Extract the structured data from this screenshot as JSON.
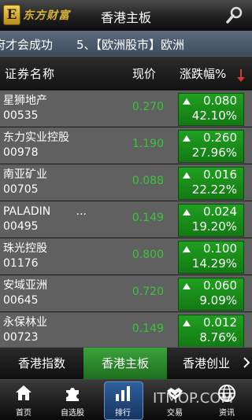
{
  "app": {
    "logo_letter": "E",
    "logo_text": "东方财富",
    "title": "香港主板"
  },
  "ticker": {
    "text": "府才会成功　　5、【欧洲股市】欧洲"
  },
  "header": {
    "name": "证券名称",
    "price": "现价",
    "change": "涨跌幅%"
  },
  "rows": [
    {
      "name": "星狮地产",
      "code": "00535",
      "price": "0.270",
      "change": "0.080",
      "pct": "42.10%"
    },
    {
      "name": "东力实业控股",
      "code": "00978",
      "price": "1.190",
      "change": "0.260",
      "pct": "27.96%"
    },
    {
      "name": "南亚矿业",
      "code": "00705",
      "price": "0.088",
      "change": "0.016",
      "pct": "22.22%"
    },
    {
      "name": "PALADIN　　 ...",
      "code": "00495",
      "price": "0.149",
      "change": "0.024",
      "pct": "19.20%"
    },
    {
      "name": "珠光控股",
      "code": "01176",
      "price": "0.800",
      "change": "0.100",
      "pct": "14.29%"
    },
    {
      "name": "安域亚洲",
      "code": "00645",
      "price": "0.720",
      "change": "0.060",
      "pct": "9.09%"
    },
    {
      "name": "永保林业",
      "code": "00723",
      "price": "0.149",
      "change": "0.012",
      "pct": "8.76%"
    }
  ],
  "tabs": [
    {
      "label": "香港指数",
      "active": false
    },
    {
      "label": "香港主板",
      "active": true
    },
    {
      "label": "香港创业",
      "active": false
    }
  ],
  "nav": [
    {
      "label": "首页",
      "icon": "home-icon"
    },
    {
      "label": "自选股",
      "icon": "puzzle-icon"
    },
    {
      "label": "排行",
      "icon": "bar-chart-icon",
      "active": true
    },
    {
      "label": "交易",
      "icon": "handshake-icon"
    },
    {
      "label": "资讯",
      "icon": "globe-icon"
    }
  ],
  "watermark": "ITMOP.COM",
  "colors": {
    "up_green": "#1fa01f",
    "price_green": "#39c43a",
    "active_tab": "#3aa33a",
    "ticker_bg": "#4d5d6e"
  }
}
